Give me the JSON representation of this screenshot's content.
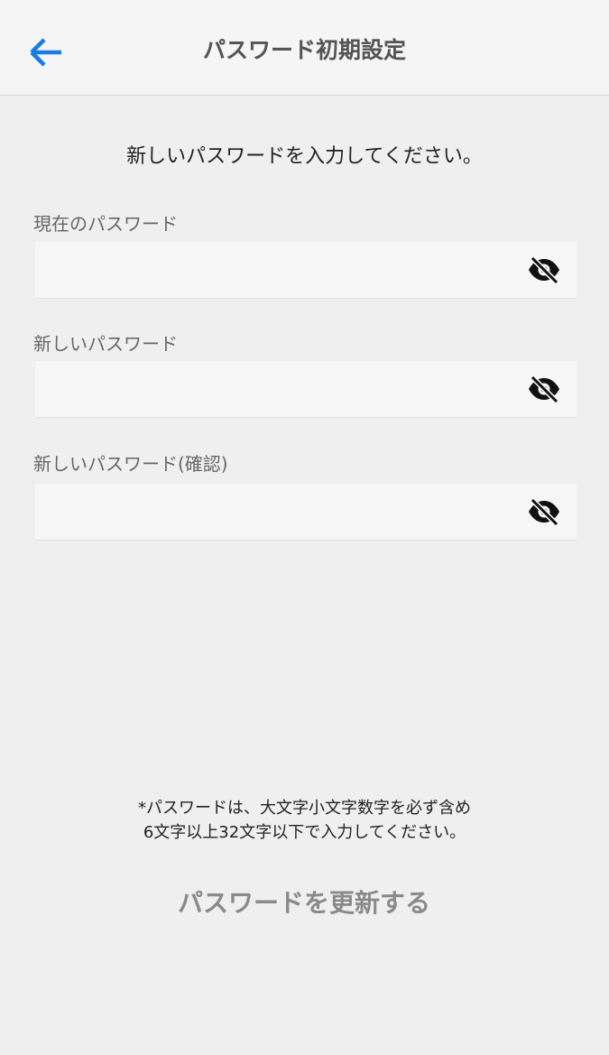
{
  "header": {
    "title": "パスワード初期設定",
    "back_icon": "arrow-left-icon",
    "accent_color": "#1a7be0"
  },
  "instruction": "新しいパスワードを入力してください。",
  "fields": [
    {
      "label": "現在のパスワード",
      "value": "",
      "icon": "eye-off-icon"
    },
    {
      "label": "新しいパスワード",
      "value": "",
      "icon": "eye-off-icon"
    },
    {
      "label": "新しいパスワード(確認)",
      "value": "",
      "icon": "eye-off-icon"
    }
  ],
  "note": {
    "line1": "*パスワードは、大文字小文字数字を必ず含め",
    "line2": "6文字以上32文字以下で入力してください。"
  },
  "submit": {
    "label": "パスワードを更新する",
    "color": "#8a8a8a"
  }
}
